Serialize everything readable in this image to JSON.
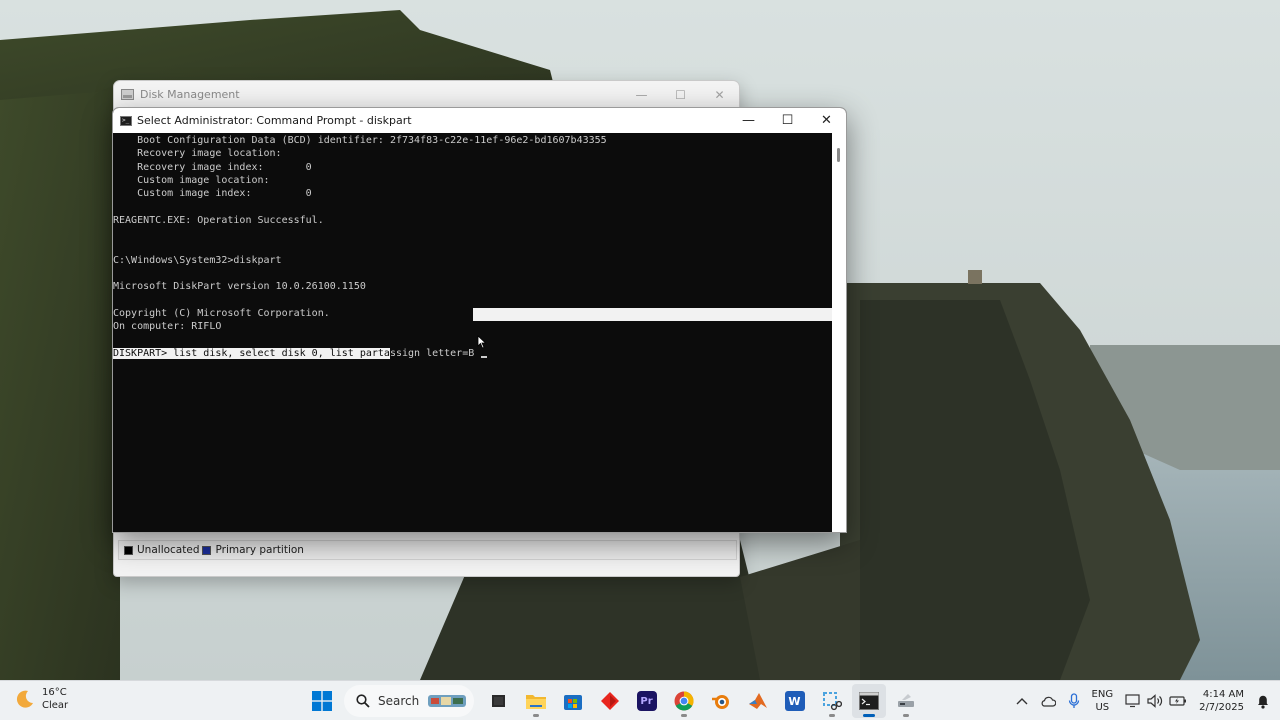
{
  "disk_management": {
    "title": "Disk Management",
    "legend": [
      {
        "label": "Unallocated",
        "color": "#000000"
      },
      {
        "label": "Primary partition",
        "color": "#1c2f9c"
      }
    ]
  },
  "cmd": {
    "title": "Select Administrator: Command Prompt - diskpart",
    "lines": [
      "    Boot Configuration Data (BCD) identifier: 2f734f83-c22e-11ef-96e2-bd1607b43355",
      "    Recovery image location:",
      "    Recovery image index:       0",
      "    Custom image location:",
      "    Custom image index:         0",
      "",
      "REAGENTC.EXE: Operation Successful.",
      "",
      "",
      "C:\\Windows\\System32>diskpart",
      "",
      "Microsoft DiskPart version 10.0.26100.1150",
      "",
      "Copyright (C) Microsoft Corporation.",
      "On computer: RIFLO",
      ""
    ],
    "prompt_selected": "DISKPART> list disk, select disk 0, list parta",
    "prompt_rest": "ssign letter=B "
  },
  "window_controls": {
    "minimize": "—",
    "maximize": "☐",
    "close": "✕"
  },
  "taskbar": {
    "weather_temp": "16°C",
    "weather_desc": "Clear",
    "search_placeholder": "Search",
    "apps": [
      {
        "name": "task-view-icon",
        "active": false
      },
      {
        "name": "file-explorer-icon",
        "active": false
      },
      {
        "name": "microsoft-store-icon",
        "active": false
      },
      {
        "name": "red-diamond-app-icon",
        "active": false
      },
      {
        "name": "premiere-pro-icon",
        "active": false
      },
      {
        "name": "chrome-icon",
        "active": false
      },
      {
        "name": "blender-icon",
        "active": false
      },
      {
        "name": "matlab-icon",
        "active": false
      },
      {
        "name": "word-icon",
        "active": false
      },
      {
        "name": "snipping-tool-icon",
        "active": false
      },
      {
        "name": "command-prompt-icon",
        "active": true
      },
      {
        "name": "disk-management-icon",
        "active": false
      }
    ],
    "premiere_label": "Pr",
    "word_label": "W",
    "language_line1": "ENG",
    "language_line2": "US",
    "time": "4:14 AM",
    "date": "2/7/2025",
    "colors": {
      "accent": "#005fb8",
      "windows_blue": "#0078d4"
    }
  }
}
